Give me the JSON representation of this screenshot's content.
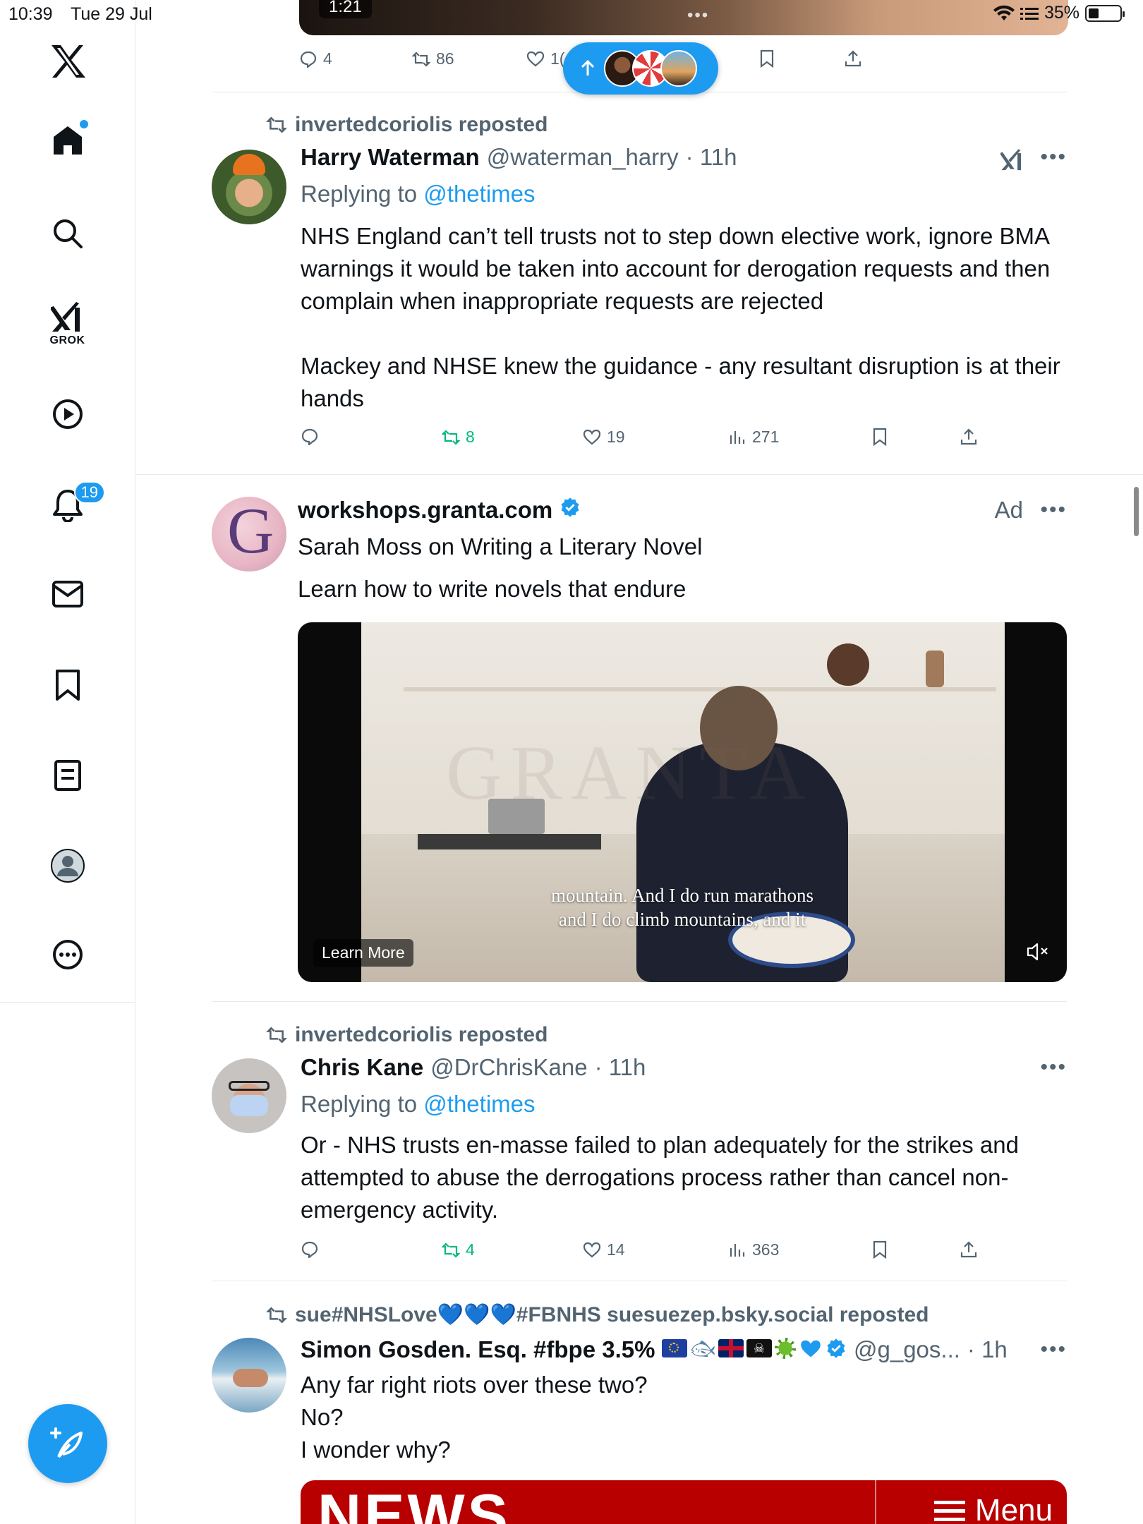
{
  "status_bar": {
    "time": "10:39",
    "date": "Tue 29 Jul",
    "battery": "35%"
  },
  "sidebar": {
    "notifications_badge": "19",
    "grok_label": "GROK"
  },
  "top_post": {
    "media_time": "1:21",
    "media_dots": "•••",
    "replies": "4",
    "reposts": "86",
    "likes": "1("
  },
  "tweets": [
    {
      "repost_by": "invertedcoriolis reposted",
      "name": "Harry Waterman",
      "handle": "@waterman_harry",
      "time": "· 11h",
      "replying_prefix": "Replying to",
      "replying_to": "@thetimes",
      "text": "NHS England can’t tell trusts not to step down elective work, ignore BMA warnings it would be taken into account for derogation requests and then complain when inappropriate requests are rejected\n\nMackey and NHSE knew the guidance - any resultant disruption is at their hands",
      "replies": "",
      "reposts": "8",
      "likes": "19",
      "views": "271"
    },
    {
      "repost_by": "invertedcoriolis reposted",
      "name": "Chris Kane",
      "handle": "@DrChrisKane",
      "time": "· 11h",
      "replying_prefix": "Replying to",
      "replying_to": "@thetimes",
      "text": "Or - NHS trusts en-masse failed to plan adequately for the strikes and attempted to abuse the derrogations process rather than cancel non-emergency activity.",
      "replies": "",
      "reposts": "4",
      "likes": "14",
      "views": "363"
    },
    {
      "repost_by": "sue#NHSLove💙💙💙#FBNHS suesuezep.bsky.social reposted",
      "name": "Simon Gosden. Esq. #fbpe 3.5%",
      "handle": "@g_gos...",
      "time": "· 1h",
      "text": "Any far right riots over these two?\nNo?\nI wonder why?"
    }
  ],
  "ad": {
    "name": "workshops.granta.com",
    "ad_label": "Ad",
    "title": "Sarah Moss on Writing a Literary Novel",
    "subtitle": "Learn how to write novels that endure",
    "caption_line1": "mountain. And I do run marathons",
    "caption_line2": "and I do climb mountains, and it",
    "watermark": "GRANTA",
    "learn_more": "Learn More",
    "avatar_letter": "G"
  },
  "news_image": {
    "text": "NEWS",
    "menu": "Menu"
  },
  "colors": {
    "accent": "#1d9bf0",
    "repost_green": "#00ba7c",
    "muted": "#536471"
  }
}
